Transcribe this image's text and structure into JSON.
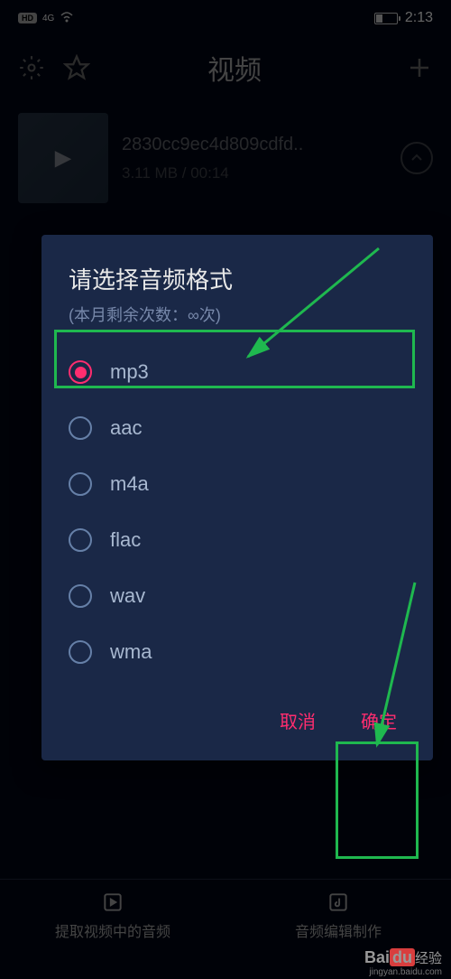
{
  "status": {
    "hd": "HD",
    "network": "4G",
    "time": "2:13"
  },
  "header": {
    "title": "视频"
  },
  "video": {
    "title": "2830cc9ec4d809cdfd..",
    "meta": "3.11 MB / 00:14"
  },
  "modal": {
    "title": "请选择音频格式",
    "subtitle": "(本月剩余次数：∞次)",
    "options": [
      "mp3",
      "aac",
      "m4a",
      "flac",
      "wav",
      "wma"
    ],
    "selected": 0,
    "cancel": "取消",
    "confirm": "确定"
  },
  "nav": {
    "extract": "提取视频中的音频",
    "edit": "音频编辑制作"
  },
  "watermark": {
    "brand_pre": "Bai",
    "brand_accent": "du",
    "brand_post": "经验",
    "url": "jingyan.baidu.com"
  }
}
